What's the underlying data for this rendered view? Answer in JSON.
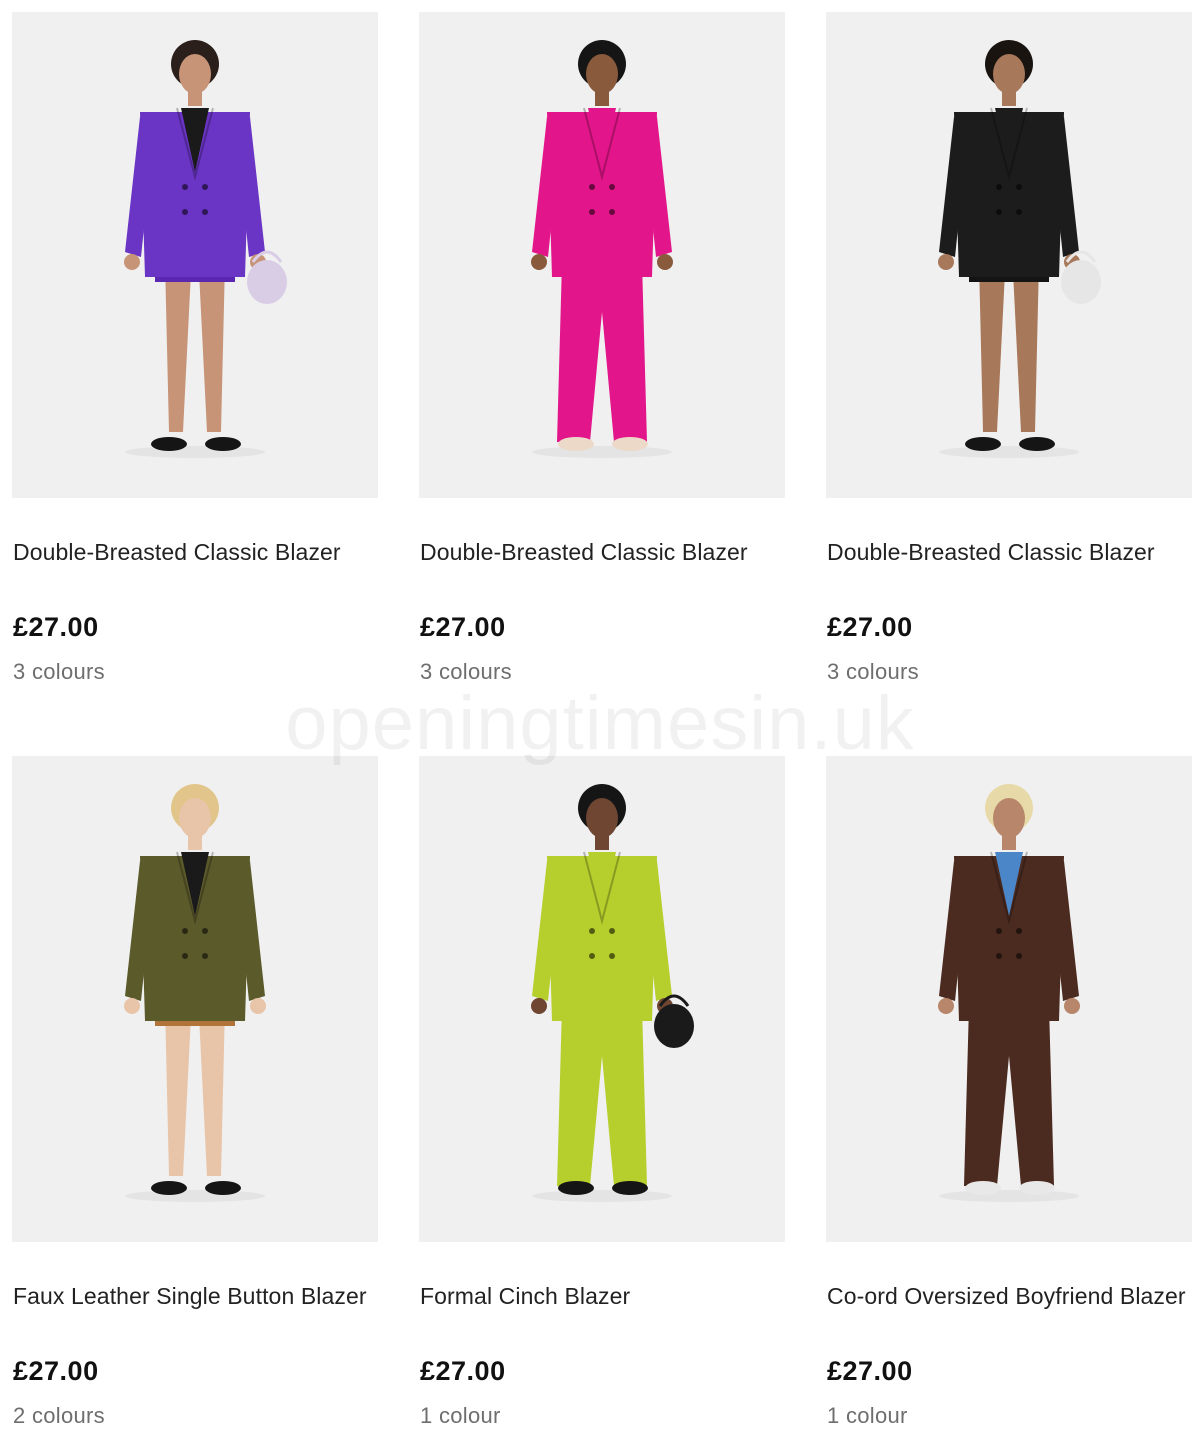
{
  "products": [
    {
      "title": "Double-Breasted Classic Blazer",
      "price": "£27.00",
      "colours": "3 colours",
      "image": "model-purple-blazer-shorts",
      "palette": {
        "blazer": "#6a34c4",
        "bottom": "#5a28b0",
        "top": "#1a1a1a",
        "skin": "#c79478",
        "hair": "#2a1f1a",
        "shoes": "#151515",
        "bag": "#d9cde6"
      }
    },
    {
      "title": "Double-Breasted Classic Blazer",
      "price": "£27.00",
      "colours": "3 colours",
      "image": "model-pink-blazer-trousers",
      "palette": {
        "blazer": "#e3158a",
        "bottom": "#e3158a",
        "top": "#e3158a",
        "skin": "#8a5a3c",
        "hair": "#151515",
        "shoes": "#ecd9c8",
        "bag": ""
      }
    },
    {
      "title": "Double-Breasted Classic Blazer",
      "price": "£27.00",
      "colours": "3 colours",
      "image": "model-black-blazer-skirt",
      "palette": {
        "blazer": "#1c1c1c",
        "bottom": "#141414",
        "top": "#1c1c1c",
        "skin": "#a8785a",
        "hair": "#1a1410",
        "shoes": "#151515",
        "bag": "#e6e6e6"
      }
    },
    {
      "title": "Faux Leather Single Button Blazer",
      "price": "£27.00",
      "colours": "2 colours",
      "image": "model-olive-leather-blazer",
      "palette": {
        "blazer": "#5b5a2b",
        "bottom": "#b0743a",
        "top": "#1a1a1a",
        "skin": "#e8c4a8",
        "hair": "#e2c58a",
        "shoes": "#151515",
        "bag": ""
      }
    },
    {
      "title": "Formal Cinch Blazer",
      "price": "£27.00",
      "colours": "1 colour",
      "image": "model-lime-blazer-trousers",
      "palette": {
        "blazer": "#b6cf2c",
        "bottom": "#b6cf2c",
        "top": "#b6cf2c",
        "skin": "#6e4632",
        "hair": "#151515",
        "shoes": "#151515",
        "bag": "#1a1a1a"
      }
    },
    {
      "title": "Co-ord Oversized Boyfriend Blazer",
      "price": "£27.00",
      "colours": "1 colour",
      "image": "model-brown-oversized-blazer",
      "palette": {
        "blazer": "#4b2a1f",
        "bottom": "#4b2a1f",
        "top": "#4a86c8",
        "skin": "#b8866a",
        "hair": "#e8d9a8",
        "shoes": "#e8e8e8",
        "bag": ""
      }
    }
  ],
  "watermark": "openingtimesin.uk"
}
